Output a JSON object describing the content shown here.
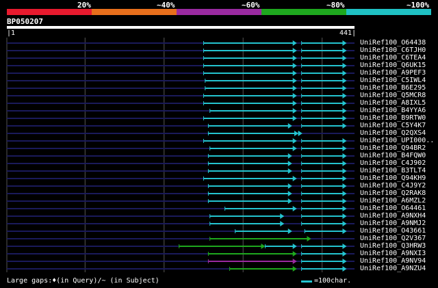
{
  "legend": {
    "labels": [
      "20%",
      "~40%",
      "~60%",
      "~80%",
      "~100%"
    ],
    "colors": [
      "#e81a2e",
      "#e86f1c",
      "#9a2aa0",
      "#1ea81e",
      "#1fc1c4"
    ]
  },
  "query": {
    "name": "BP050207",
    "start": "1",
    "end": "441",
    "length": 441
  },
  "colors": {
    "cyan": "#24c4d0",
    "green": "#1ea81e",
    "purple": "#9a2aa0",
    "navy": "#1a1a5a",
    "grid": "#555555"
  },
  "hits": [
    {
      "label": "UniRef100_O64438",
      "segments": [
        [
          1,
          100,
          "navy"
        ],
        [
          250,
          368,
          "cyan"
        ],
        [
          374,
          431,
          "cyan"
        ]
      ]
    },
    {
      "label": "UniRef100_C6TJH0",
      "segments": [
        [
          1,
          100,
          "navy"
        ],
        [
          250,
          368,
          "cyan"
        ],
        [
          374,
          431,
          "cyan"
        ]
      ]
    },
    {
      "label": "UniRef100_C6TEA4",
      "segments": [
        [
          1,
          100,
          "navy"
        ],
        [
          250,
          368,
          "cyan"
        ],
        [
          374,
          431,
          "cyan"
        ]
      ]
    },
    {
      "label": "UniRef100_Q6UK15",
      "segments": [
        [
          1,
          100,
          "navy"
        ],
        [
          250,
          368,
          "cyan"
        ],
        [
          374,
          431,
          "cyan"
        ]
      ]
    },
    {
      "label": "UniRef100_A9PEF3",
      "segments": [
        [
          1,
          100,
          "navy"
        ],
        [
          250,
          368,
          "cyan"
        ],
        [
          374,
          431,
          "cyan"
        ]
      ]
    },
    {
      "label": "UniRef100_C5IWL4",
      "segments": [
        [
          1,
          100,
          "navy"
        ],
        [
          252,
          368,
          "cyan"
        ],
        [
          374,
          431,
          "cyan"
        ]
      ]
    },
    {
      "label": "UniRef100_B6E295",
      "segments": [
        [
          1,
          100,
          "navy"
        ],
        [
          252,
          368,
          "cyan"
        ],
        [
          374,
          431,
          "cyan"
        ]
      ]
    },
    {
      "label": "UniRef100_Q5MCR8",
      "segments": [
        [
          1,
          100,
          "navy"
        ],
        [
          250,
          368,
          "cyan"
        ],
        [
          374,
          431,
          "cyan"
        ]
      ]
    },
    {
      "label": "UniRef100_A8IXL5",
      "segments": [
        [
          1,
          100,
          "navy"
        ],
        [
          250,
          368,
          "cyan"
        ],
        [
          374,
          431,
          "cyan"
        ]
      ]
    },
    {
      "label": "UniRef100_B4YYA6",
      "segments": [
        [
          1,
          100,
          "navy"
        ],
        [
          258,
          368,
          "cyan"
        ],
        [
          374,
          431,
          "cyan"
        ]
      ]
    },
    {
      "label": "UniRef100_B9RTW0",
      "segments": [
        [
          1,
          100,
          "navy"
        ],
        [
          250,
          368,
          "cyan"
        ],
        [
          374,
          431,
          "cyan"
        ]
      ]
    },
    {
      "label": "UniRef100_C5Y4K7",
      "segments": [
        [
          1,
          100,
          "navy"
        ],
        [
          256,
          362,
          "cyan"
        ],
        [
          374,
          431,
          "cyan"
        ]
      ]
    },
    {
      "label": "UniRef100_Q2QXS4",
      "segments": [
        [
          1,
          100,
          "navy"
        ],
        [
          256,
          370,
          "cyan"
        ],
        [
          370,
          375,
          "cyan"
        ]
      ]
    },
    {
      "label": "UniRef100_UPI000..",
      "segments": [
        [
          1,
          100,
          "navy"
        ],
        [
          250,
          368,
          "cyan"
        ],
        [
          374,
          431,
          "cyan"
        ]
      ]
    },
    {
      "label": "UniRef100_Q94BR2",
      "segments": [
        [
          1,
          100,
          "navy"
        ],
        [
          258,
          368,
          "cyan"
        ],
        [
          374,
          431,
          "cyan"
        ]
      ]
    },
    {
      "label": "UniRef100_B4FQW0",
      "segments": [
        [
          1,
          100,
          "navy"
        ],
        [
          256,
          362,
          "cyan"
        ],
        [
          374,
          431,
          "cyan"
        ]
      ]
    },
    {
      "label": "UniRef100_C4J902",
      "segments": [
        [
          1,
          100,
          "navy"
        ],
        [
          256,
          362,
          "cyan"
        ],
        [
          374,
          431,
          "cyan"
        ]
      ]
    },
    {
      "label": "UniRef100_B3TLT4",
      "segments": [
        [
          1,
          100,
          "navy"
        ],
        [
          256,
          362,
          "cyan"
        ],
        [
          374,
          431,
          "cyan"
        ]
      ]
    },
    {
      "label": "UniRef100_Q94KH9",
      "segments": [
        [
          1,
          100,
          "navy"
        ],
        [
          250,
          368,
          "cyan"
        ],
        [
          374,
          431,
          "cyan"
        ]
      ]
    },
    {
      "label": "UniRef100_C4J9Y2",
      "segments": [
        [
          1,
          100,
          "navy"
        ],
        [
          256,
          362,
          "cyan"
        ],
        [
          374,
          431,
          "cyan"
        ]
      ]
    },
    {
      "label": "UniRef100_Q2RAK8",
      "segments": [
        [
          1,
          100,
          "navy"
        ],
        [
          256,
          362,
          "cyan"
        ],
        [
          374,
          431,
          "cyan"
        ]
      ]
    },
    {
      "label": "UniRef100_A6MZL2",
      "segments": [
        [
          1,
          100,
          "navy"
        ],
        [
          256,
          362,
          "cyan"
        ],
        [
          374,
          431,
          "cyan"
        ]
      ]
    },
    {
      "label": "UniRef100_O64461",
      "segments": [
        [
          1,
          100,
          "navy"
        ],
        [
          277,
          368,
          "cyan"
        ],
        [
          374,
          431,
          "cyan"
        ]
      ]
    },
    {
      "label": "UniRef100_A9NXH4",
      "segments": [
        [
          1,
          100,
          "navy"
        ],
        [
          258,
          352,
          "cyan"
        ],
        [
          374,
          431,
          "cyan"
        ]
      ]
    },
    {
      "label": "UniRef100_A9NMJ2",
      "segments": [
        [
          1,
          100,
          "navy"
        ],
        [
          258,
          352,
          "cyan"
        ],
        [
          374,
          431,
          "cyan"
        ]
      ]
    },
    {
      "label": "UniRef100_O43661",
      "segments": [
        [
          1,
          100,
          "navy"
        ],
        [
          290,
          362,
          "cyan"
        ],
        [
          378,
          431,
          "cyan"
        ]
      ]
    },
    {
      "label": "UniRef100_Q2V367",
      "segments": [
        [
          1,
          100,
          "navy"
        ],
        [
          258,
          386,
          "green"
        ]
      ]
    },
    {
      "label": "UniRef100_Q3HRW3",
      "segments": [
        [
          219,
          328,
          "green"
        ],
        [
          328,
          368,
          "cyan"
        ],
        [
          374,
          431,
          "cyan"
        ]
      ]
    },
    {
      "label": "UniRef100_A9NXI3",
      "segments": [
        [
          1,
          100,
          "navy"
        ],
        [
          256,
          368,
          "green"
        ],
        [
          374,
          431,
          "cyan"
        ]
      ]
    },
    {
      "label": "UniRef100_A9NV94",
      "segments": [
        [
          1,
          100,
          "navy"
        ],
        [
          256,
          368,
          "purple"
        ],
        [
          374,
          431,
          "cyan"
        ]
      ]
    },
    {
      "label": "UniRef100_A9NZU4",
      "segments": [
        [
          1,
          100,
          "navy"
        ],
        [
          283,
          368,
          "green"
        ],
        [
          374,
          431,
          "cyan"
        ]
      ]
    }
  ],
  "footer": {
    "gaps_text": "Large gaps:♦(in Query)/~ (in Subject)",
    "scale_text": "=100char."
  }
}
